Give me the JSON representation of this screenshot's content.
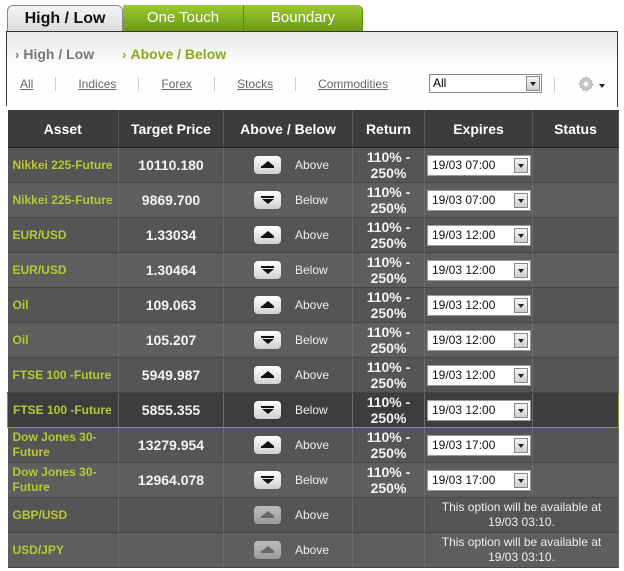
{
  "tabs": [
    {
      "label": "High / Low",
      "active": true
    },
    {
      "label": "One Touch",
      "active": false
    },
    {
      "label": "Boundary",
      "active": false
    }
  ],
  "subnav": [
    {
      "label": "High / Low",
      "active": false
    },
    {
      "label": "Above / Below",
      "active": true
    }
  ],
  "filters": [
    "All",
    "Indices",
    "Forex",
    "Stocks",
    "Commodities"
  ],
  "asset_select": {
    "value": "All"
  },
  "icons": {
    "settings": "gear-icon",
    "settings_caret": "caret-down-icon"
  },
  "table": {
    "headers": [
      "Asset",
      "Target Price",
      "Above / Below",
      "Return",
      "Expires",
      "Status"
    ],
    "rows": [
      {
        "asset": "Nikkei 225-Future",
        "price": "10110.180",
        "direction": "Above",
        "return_top": "110% -",
        "return_bottom": "250%",
        "expires": "19/03 07:00",
        "status": ""
      },
      {
        "asset": "Nikkei 225-Future",
        "price": "9869.700",
        "direction": "Below",
        "return_top": "110% -",
        "return_bottom": "250%",
        "expires": "19/03 07:00",
        "status": ""
      },
      {
        "asset": "EUR/USD",
        "price": "1.33034",
        "direction": "Above",
        "return_top": "110% -",
        "return_bottom": "250%",
        "expires": "19/03 12:00",
        "status": ""
      },
      {
        "asset": "EUR/USD",
        "price": "1.30464",
        "direction": "Below",
        "return_top": "110% -",
        "return_bottom": "250%",
        "expires": "19/03 12:00",
        "status": ""
      },
      {
        "asset": "Oil",
        "price": "109.063",
        "direction": "Above",
        "return_top": "110% -",
        "return_bottom": "250%",
        "expires": "19/03 12:00",
        "status": ""
      },
      {
        "asset": "Oil",
        "price": "105.207",
        "direction": "Below",
        "return_top": "110% -",
        "return_bottom": "250%",
        "expires": "19/03 12:00",
        "status": ""
      },
      {
        "asset": "FTSE 100 -Future",
        "price": "5949.987",
        "direction": "Above",
        "return_top": "110% -",
        "return_bottom": "250%",
        "expires": "19/03 12:00",
        "status": ""
      },
      {
        "asset": "FTSE 100 -Future",
        "price": "5855.355",
        "direction": "Below",
        "return_top": "110% -",
        "return_bottom": "250%",
        "expires": "19/03 12:00",
        "status": "",
        "selected": true
      },
      {
        "asset": "Dow Jones 30-Future",
        "price": "13279.954",
        "direction": "Above",
        "return_top": "110% -",
        "return_bottom": "250%",
        "expires": "19/03 17:00",
        "status": ""
      },
      {
        "asset": "Dow Jones 30-Future",
        "price": "12964.078",
        "direction": "Below",
        "return_top": "110% -",
        "return_bottom": "250%",
        "expires": "19/03 17:00",
        "status": ""
      }
    ],
    "unavailable_rows": [
      {
        "asset": "GBP/USD",
        "direction": "Above",
        "note_line1": "This option will be available at",
        "note_line2": "19/03 03:10."
      },
      {
        "asset": "USD/JPY",
        "direction": "Above",
        "note_line1": "This option will be available at",
        "note_line2": "19/03 03:10."
      }
    ]
  },
  "colors": {
    "accent_green": "#8aaa1e",
    "asset_text": "#b7c836",
    "header_bg": "#3c3c3c",
    "selected_border": "#8c9a3c"
  }
}
